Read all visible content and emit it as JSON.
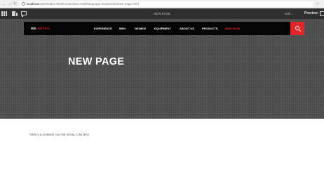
{
  "browser": {
    "url_host": "localhost",
    "url_path": ":4502/editor.html/content/we-retail/language-masters/en/new-page.html"
  },
  "editor": {
    "page_title": "NEW PAGE",
    "mode_label": "Edit",
    "preview_label": "Preview"
  },
  "site": {
    "logo_prefix": "WE.",
    "logo_suffix": "RETAIL",
    "nav": [
      "EXPERIENCE",
      "MEN",
      "WOMEN",
      "EQUIPMENT",
      "ABOUT US",
      "PRODUCTS",
      "NEW PAGE"
    ],
    "active_index": 6,
    "accent_color": "#e3252a"
  },
  "hero": {
    "title": "NEW PAGE"
  },
  "content": {
    "text": "THIS IS A CHANGE ON THE INTIAL CONTENT"
  }
}
